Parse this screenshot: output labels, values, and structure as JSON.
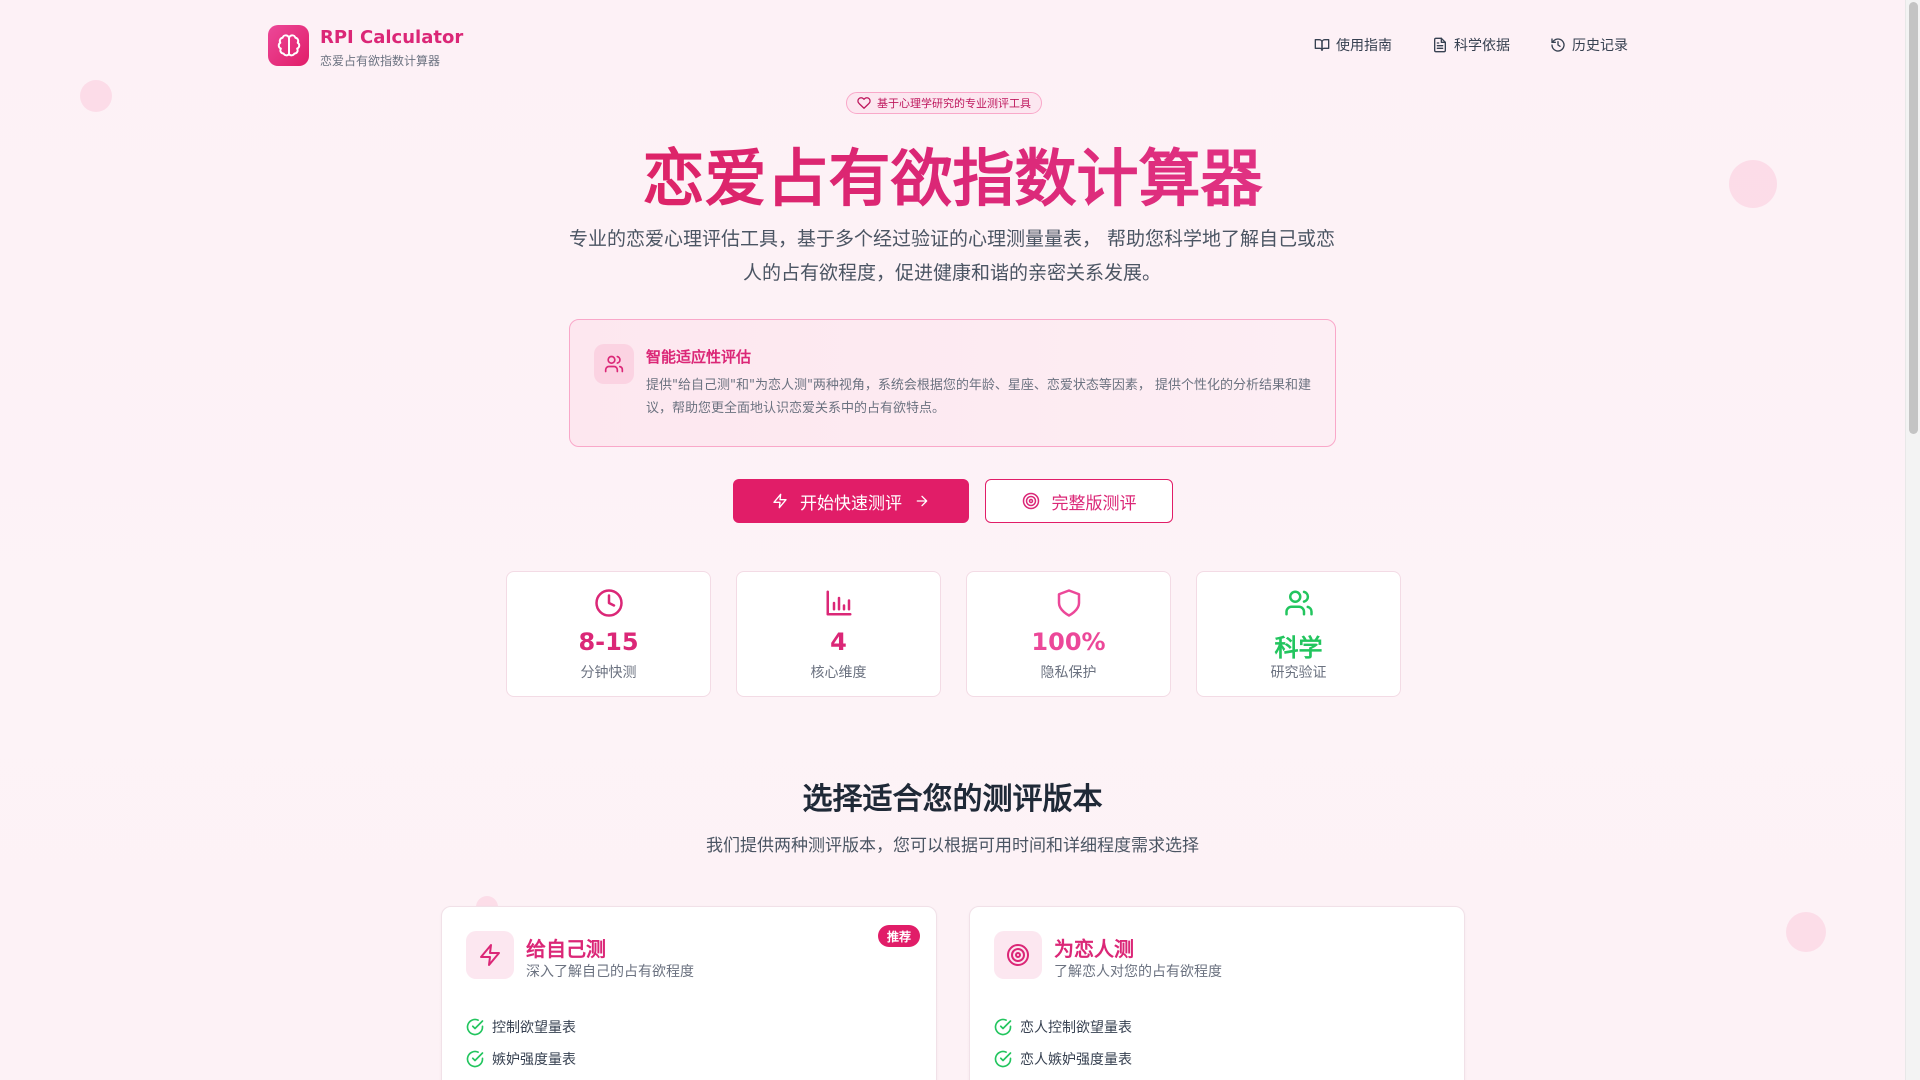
{
  "header": {
    "app_title": "RPI Calculator",
    "app_subtitle": "恋爱占有欲指数计算器",
    "nav": [
      {
        "label": "使用指南",
        "icon": "book-open-icon"
      },
      {
        "label": "科学依据",
        "icon": "file-text-icon"
      },
      {
        "label": "历史记录",
        "icon": "history-icon"
      }
    ]
  },
  "hero": {
    "badge": "基于心理学研究的专业测评工具",
    "title": "恋爱占有欲指数计算器",
    "description": "专业的恋爱心理评估工具，基于多个经过验证的心理测量量表， 帮助您科学地了解自己或恋人的占有欲程度，促进健康和谐的亲密关系发展。"
  },
  "info_card": {
    "title": "智能适应性评估",
    "text": "提供\"给自己测\"和\"为恋人测\"两种视角，系统会根据您的年龄、星座、恋爱状态等因素， 提供个性化的分析结果和建议，帮助您更全面地认识恋爱关系中的占有欲特点。",
    "icon": "users-icon"
  },
  "actions": {
    "quick_label": "开始快速测评",
    "full_label": "完整版测评"
  },
  "stats": [
    {
      "value": "8-15",
      "label": "分钟快测",
      "icon": "clock-icon",
      "color": "#db2777"
    },
    {
      "value": "4",
      "label": "核心维度",
      "icon": "bar-chart-icon",
      "color": "#db2777"
    },
    {
      "value": "100%",
      "label": "隐私保护",
      "icon": "shield-icon",
      "color": "#ec4899"
    },
    {
      "value": "科学",
      "label": "研究验证",
      "icon": "users-icon",
      "color": "#22c55e"
    }
  ],
  "versions_section": {
    "title": "选择适合您的测评版本",
    "subtitle": "我们提供两种测评版本，您可以根据可用时间和详细程度需求选择"
  },
  "versions": [
    {
      "title": "给自己测",
      "subtitle": "深入了解自己的占有欲程度",
      "tag": "推荐",
      "icon": "zap-icon",
      "features": [
        "控制欲望量表",
        "嫉妒强度量表"
      ]
    },
    {
      "title": "为恋人测",
      "subtitle": "了解恋人对您的占有欲程度",
      "icon": "target-icon",
      "features": [
        "恋人控制欲望量表",
        "恋人嫉妒强度量表"
      ]
    }
  ],
  "colors": {
    "accent": "#e11d68",
    "brand_pink": "#db2777",
    "success": "#22c55e",
    "background": "#fdf2f6"
  }
}
